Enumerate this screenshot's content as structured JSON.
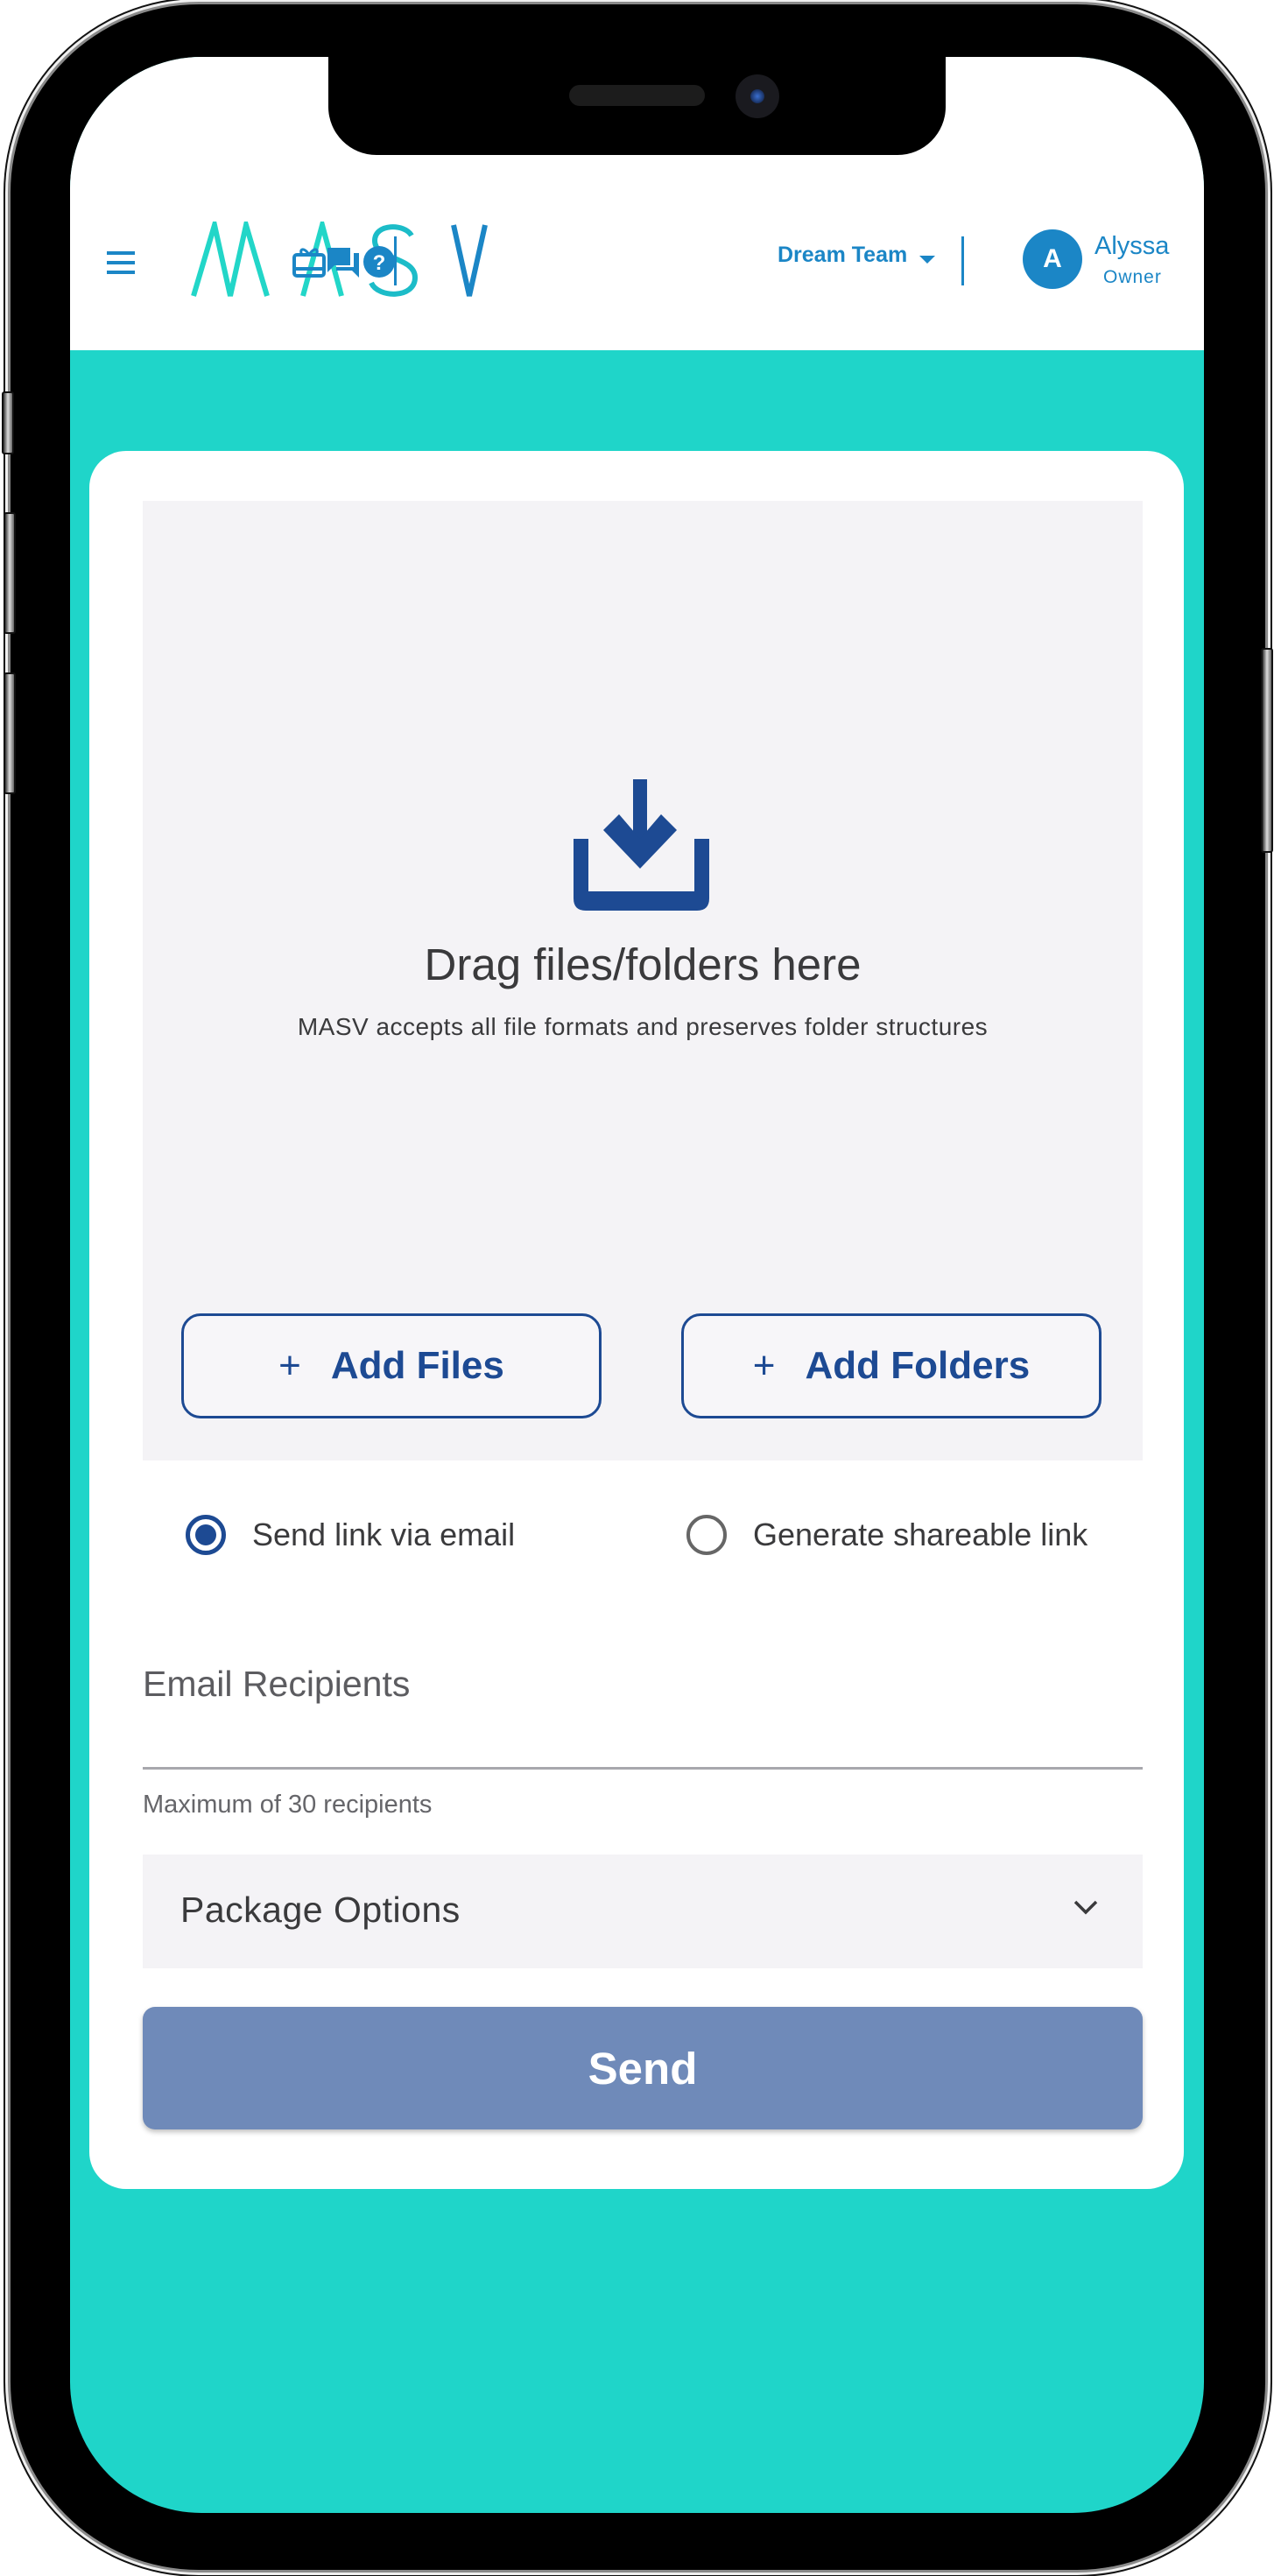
{
  "header": {
    "logo_text": "MASV",
    "icons": [
      "menu-icon",
      "gift-icon",
      "chat-icon",
      "help-icon"
    ],
    "team_selector": "Dream Team",
    "user": {
      "avatar_initial": "A",
      "name": "Alyssa",
      "role": "Owner"
    }
  },
  "dropzone": {
    "icon": "download-tray-icon",
    "title": "Drag files/folders here",
    "subtitle": "MASV accepts all file formats and preserves folder structures",
    "add_files_label": "Add Files",
    "add_folders_label": "Add Folders",
    "plus_glyph": "+"
  },
  "delivery": {
    "options": [
      {
        "label": "Send link via email",
        "selected": true
      },
      {
        "label": "Generate shareable link",
        "selected": false
      }
    ]
  },
  "email": {
    "label": "Email Recipients",
    "value": "",
    "helper": "Maximum of 30 recipients"
  },
  "package_options": {
    "label": "Package Options",
    "icon": "chevron-down-icon"
  },
  "send_button": {
    "label": "Send",
    "enabled": false
  },
  "colors": {
    "brand_teal": "#1fd5c9",
    "brand_blue": "#1b86c6",
    "primary_navy": "#1d4a93",
    "send_disabled": "#6f8ab9",
    "surface_gray": "#f4f3f6"
  }
}
